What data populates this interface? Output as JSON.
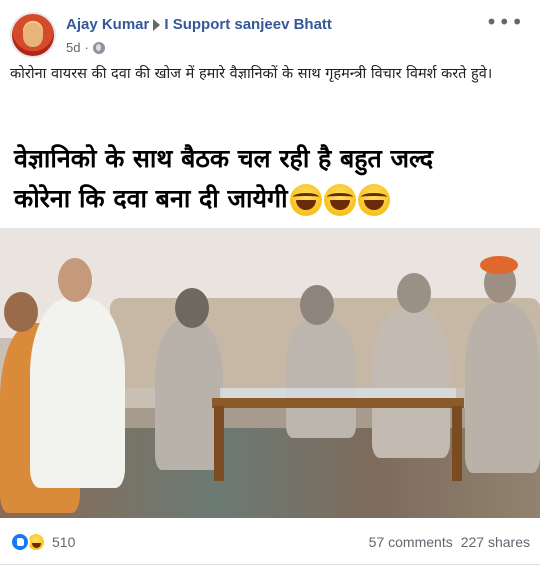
{
  "post": {
    "author": "Ajay Kumar",
    "group": "I Support sanjeev Bhatt",
    "time": "5d",
    "privacy_icon": "globe-icon",
    "more_icon": "more-options-icon",
    "caption": "कोरोना वायरस की दवा की खोज में हमारे वैज्ञानिकों के साथ गृहमन्त्री विचार विमर्श करते हुवे।"
  },
  "image": {
    "meme_line1": "वेज्ञानिको के साथ बैठक चल रही है बहुत जल्द",
    "meme_line2": "कोरेना कि दवा बना दी जायेगी",
    "emoji_names": [
      "laughing-tears-emoji",
      "laughing-tears-emoji",
      "laughing-tears-emoji"
    ]
  },
  "footer": {
    "reaction_icons": [
      "like-reaction-icon",
      "haha-reaction-icon"
    ],
    "reactions_count": "510",
    "comments": "57 comments",
    "shares": "227 shares"
  },
  "colors": {
    "author_link": "#365899",
    "meta_text": "#606770",
    "like_blue": "#1877f2"
  }
}
